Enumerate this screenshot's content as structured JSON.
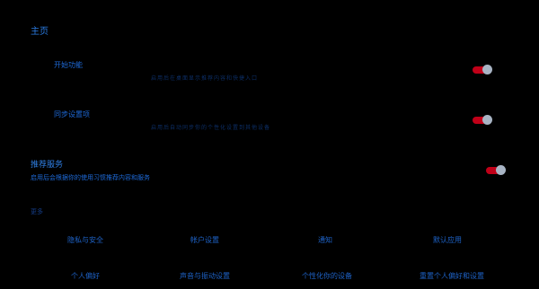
{
  "section1": {
    "title": "主页",
    "rows": [
      {
        "label": "开始功能",
        "desc": "启用后在桌面显示推荐内容和快捷入口",
        "enabled": true
      },
      {
        "label": "同步设置项",
        "desc": "启用后自动同步你的个性化设置到其他设备",
        "enabled": true
      }
    ]
  },
  "section2": {
    "title": "推荐服务",
    "desc": "启用后会根据你的使用习惯推荐内容和服务",
    "enabled": true
  },
  "section3": {
    "title": "更多",
    "items": [
      "隐私与安全",
      "帐户设置",
      "通知",
      "默认应用",
      "个人偏好",
      "声音与振动设置",
      "个性化你的设备",
      "重置个人偏好和设置"
    ]
  },
  "colors": {
    "toggle_on": "#c00018",
    "knob": "#a8b4c4",
    "accent": "#1e64c8"
  }
}
